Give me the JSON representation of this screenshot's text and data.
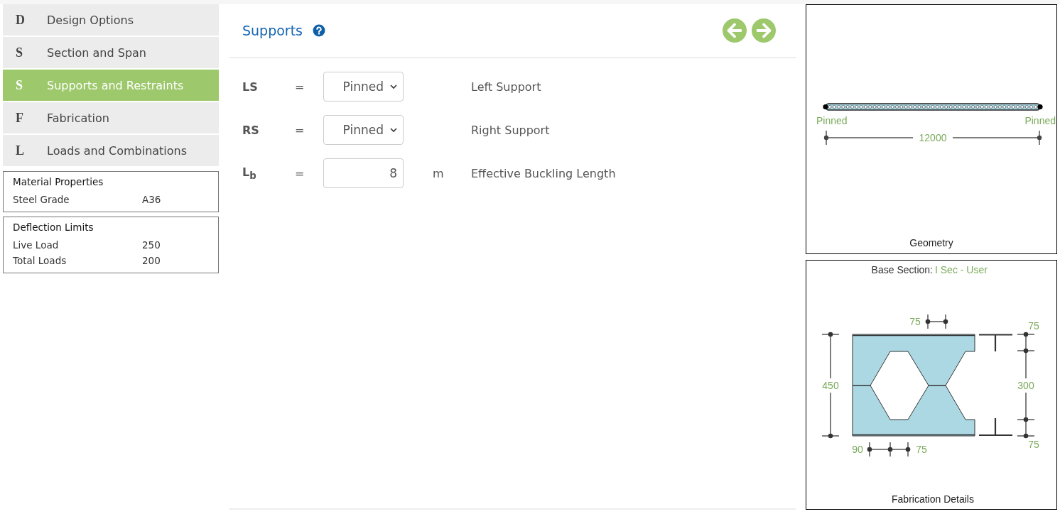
{
  "steps": [
    {
      "letter": "D",
      "label": "Design Options",
      "selected": false
    },
    {
      "letter": "S",
      "label": "Section and Span",
      "selected": false
    },
    {
      "letter": "S",
      "label": "Supports and Restraints",
      "selected": true
    },
    {
      "letter": "F",
      "label": "Fabrication",
      "selected": false
    },
    {
      "letter": "L",
      "label": "Loads and Combinations",
      "selected": false
    }
  ],
  "info_boxes": [
    {
      "title": "Material Properties",
      "rows": [
        {
          "label": "Steel Grade",
          "value": "A36"
        }
      ]
    },
    {
      "title": "Deflection Limits",
      "rows": [
        {
          "label": "Live Load",
          "value": "250"
        },
        {
          "label": "Total Loads",
          "value": "200"
        }
      ]
    }
  ],
  "main": {
    "title": "Supports",
    "fields": [
      {
        "kind": "select",
        "symbol": "LS",
        "equals": "=",
        "value": "Pinned",
        "description": "Left Support"
      },
      {
        "kind": "select",
        "symbol": "RS",
        "equals": "=",
        "value": "Pinned",
        "description": "Right Support"
      },
      {
        "kind": "input",
        "symbol": "L$_{b}$",
        "equals": "=",
        "value": "8",
        "unit": "m",
        "description": "Effective Buckling Length"
      }
    ]
  },
  "geometry": {
    "left_support": "Pinned",
    "right_support": "Pinned",
    "span": "12000",
    "caption": "Geometry"
  },
  "fabrication": {
    "base_label": "Base Section:",
    "base_value": "I Sec - User",
    "top_dim": "75",
    "left_dim": "450",
    "right_top_dim": "75",
    "right_mid_dim": "300",
    "right_bottom_dim": "75",
    "bottom_left_dim": "90",
    "bottom_right_dim": "75",
    "caption": "Fabrication Details"
  }
}
